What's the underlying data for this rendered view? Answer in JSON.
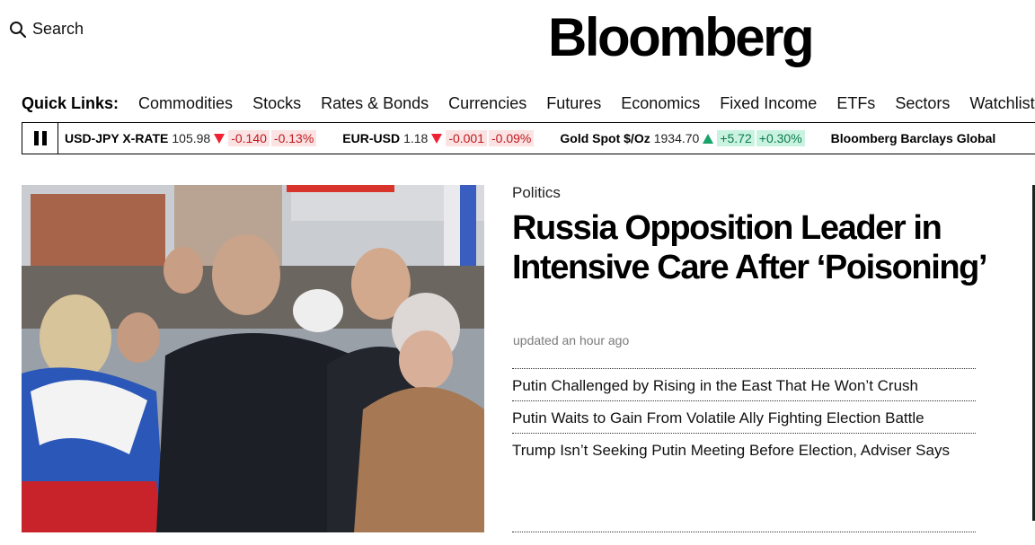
{
  "header": {
    "search_label": "Search",
    "logo_text": "Bloomberg"
  },
  "quick_links": {
    "title": "Quick Links:",
    "items": [
      "Commodities",
      "Stocks",
      "Rates & Bonds",
      "Currencies",
      "Futures",
      "Economics",
      "Fixed Income",
      "ETFs",
      "Sectors",
      "Watchlist"
    ]
  },
  "ticker": {
    "items": [
      {
        "name": "USD-JPY X-RATE",
        "price": "105.98",
        "direction": "down",
        "change": "-0.140",
        "pct": "-0.13%"
      },
      {
        "name": "EUR-USD",
        "price": "1.18",
        "direction": "down",
        "change": "-0.001",
        "pct": "-0.09%"
      },
      {
        "name": "Gold Spot $/Oz",
        "price": "1934.70",
        "direction": "up",
        "change": "+5.72",
        "pct": "+0.30%"
      },
      {
        "name": "Bloomberg Barclays Global",
        "price": "",
        "direction": "",
        "change": "",
        "pct": ""
      }
    ],
    "colors": {
      "down": "#e23333",
      "up": "#19a36a"
    }
  },
  "story": {
    "kicker": "Politics",
    "headline": "Russia Opposition Leader in Intensive Care After ‘Poisoning’",
    "updated": "updated an hour ago",
    "related": [
      "Putin Challenged by Rising in the East That He Won’t Crush",
      "Putin Waits to Gain From Volatile Ally Fighting Election Battle",
      "Trump Isn’t Seeking Putin Meeting Before Election, Adviser Says"
    ]
  }
}
